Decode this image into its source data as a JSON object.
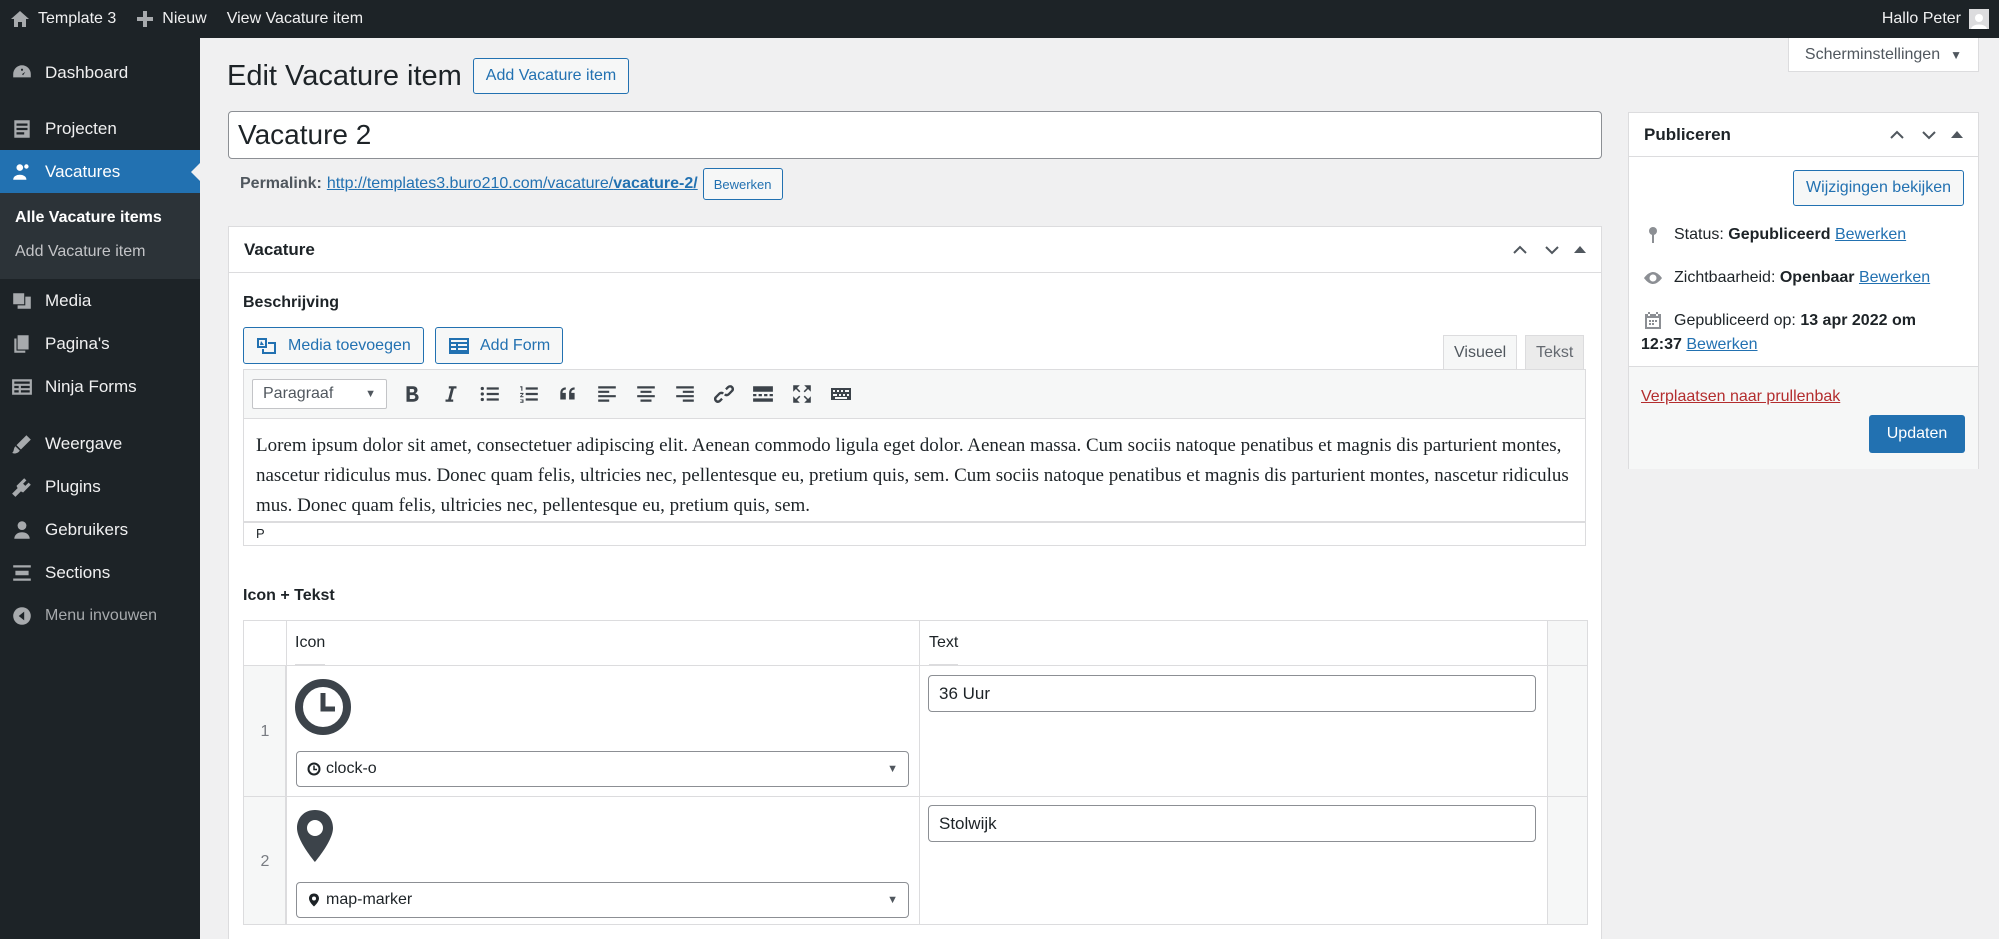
{
  "adminbar": {
    "site_name": "Template 3",
    "new_label": "Nieuw",
    "view_label": "View Vacature item",
    "greeting": "Hallo Peter"
  },
  "sidebar": {
    "items": [
      {
        "label": "Dashboard",
        "icon": "dashboard-icon"
      },
      {
        "label": "Projecten",
        "icon": "post-icon"
      },
      {
        "label": "Vacatures",
        "icon": "users-icon",
        "active": true
      },
      {
        "label": "Media",
        "icon": "media-icon"
      },
      {
        "label": "Pagina's",
        "icon": "pages-icon"
      },
      {
        "label": "Ninja Forms",
        "icon": "forms-icon"
      },
      {
        "label": "Weergave",
        "icon": "appearance-icon"
      },
      {
        "label": "Plugins",
        "icon": "plugins-icon"
      },
      {
        "label": "Gebruikers",
        "icon": "user-icon"
      },
      {
        "label": "Sections",
        "icon": "sections-icon"
      }
    ],
    "submenu": [
      "Alle Vacature items",
      "Add Vacature item"
    ],
    "collapse_label": "Menu invouwen"
  },
  "screen_options": "Scherminstellingen",
  "page": {
    "title": "Edit Vacature item",
    "add_button": "Add Vacature item",
    "post_title": "Vacature 2",
    "permalink_label": "Permalink:",
    "permalink_base": "http://templates3.buro210.com/vacature/",
    "permalink_slug": "vacature-2/",
    "permalink_edit": "Bewerken"
  },
  "vacature_box": {
    "title": "Vacature",
    "description_label": "Beschrijving",
    "media_button": "Media toevoegen",
    "form_button": "Add Form",
    "tab_visual": "Visueel",
    "tab_text": "Tekst",
    "format_select": "Paragraaf",
    "content": "Lorem ipsum dolor sit amet, consectetuer adipiscing elit. Aenean commodo ligula eget dolor. Aenean massa. Cum sociis natoque penatibus et magnis dis parturient montes, nascetur ridiculus mus. Donec quam felis, ultricies nec, pellentesque eu, pretium quis, sem. Cum sociis natoque penatibus et magnis dis parturient montes, nascetur ridiculus mus. Donec quam felis, ultricies nec, pellentesque eu, pretium quis, sem.",
    "status_path": "P",
    "repeater_label": "Icon + Tekst",
    "col_icon": "Icon",
    "col_text": "Text",
    "rows": [
      {
        "num": "1",
        "icon_value": "clock-o",
        "text": "36 Uur"
      },
      {
        "num": "2",
        "icon_value": "map-marker",
        "text": "Stolwijk"
      }
    ]
  },
  "publish": {
    "title": "Publiceren",
    "preview_button": "Wijzigingen bekijken",
    "status_label": "Status:",
    "status_value": "Gepubliceerd",
    "visibility_label": "Zichtbaarheid:",
    "visibility_value": "Openbaar",
    "published_label": "Gepubliceerd op:",
    "published_date": "13 apr 2022 om",
    "published_time": "12:37",
    "edit_link": "Bewerken",
    "trash_link": "Verplaatsen naar prullenbak",
    "update_button": "Updaten"
  }
}
